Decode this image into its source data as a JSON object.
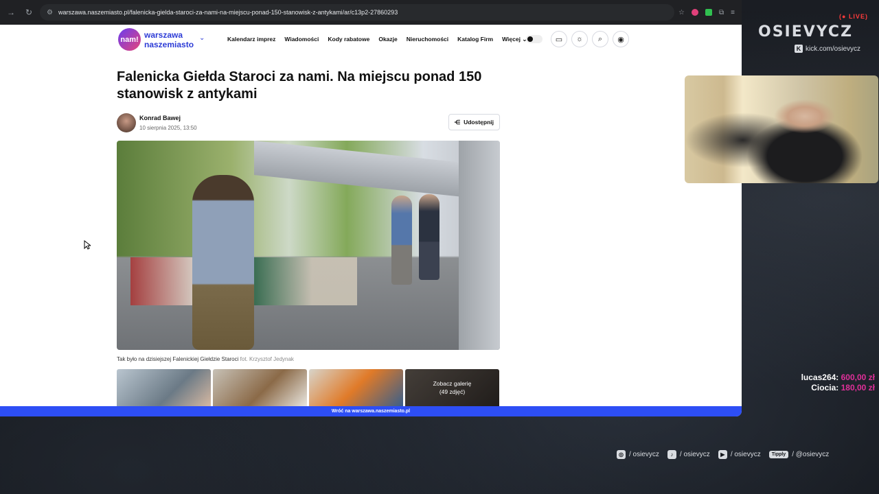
{
  "browser": {
    "url": "warszawa.naszemiasto.pl/falenicka-gielda-staroci-za-nami-na-miejscu-ponad-150-stanowisk-z-antykami/ar/c13p2-27860293"
  },
  "site": {
    "logo_badge": "nam!",
    "logo_line1": "warszawa",
    "logo_line2": "naszemiasto",
    "nav": [
      "Kalendarz imprez",
      "Wiadomości",
      "Kody rabatowe",
      "Okazje",
      "Nieruchomości",
      "Katalog Firm",
      "Więcej"
    ]
  },
  "article": {
    "title": "Falenicka Giełda Staroci za nami. Na miejscu ponad 150 stanowisk z antykami",
    "author": "Konrad Bawej",
    "date": "10 sierpnia 2025, 13:50",
    "share_label": "Udostępnij",
    "caption": "Tak było na dzisiejszej Falenickiej Giełdzie Staroci",
    "credit": "fot. Krzysztof Jedynak",
    "gallery_label_1": "Zobacz galerię",
    "gallery_label_2": "(49 zdjęć)",
    "bottom_bar": "Wróć na warszawa.naszemiasto.pl"
  },
  "overlay": {
    "live": "LIVE",
    "channel": "OSIEVYCZ",
    "kick": "kick.com/osievycz",
    "donations": [
      {
        "name": "lucas264:",
        "amount": "600,00 zł"
      },
      {
        "name": "Ciocia:",
        "amount": "180,00 zł"
      }
    ],
    "socials": [
      {
        "label": "/ osievycz",
        "icon": "instagram-icon"
      },
      {
        "label": "/ osievycz",
        "icon": "tiktok-icon"
      },
      {
        "label": "/ osievycz",
        "icon": "youtube-icon"
      },
      {
        "label": "/ @osievycz",
        "icon": "tipply-icon",
        "badge": "Tipply"
      }
    ]
  },
  "colors": {
    "accent": "#2d4ef5",
    "live": "#ff3b3b",
    "donation": "#e0309a"
  }
}
